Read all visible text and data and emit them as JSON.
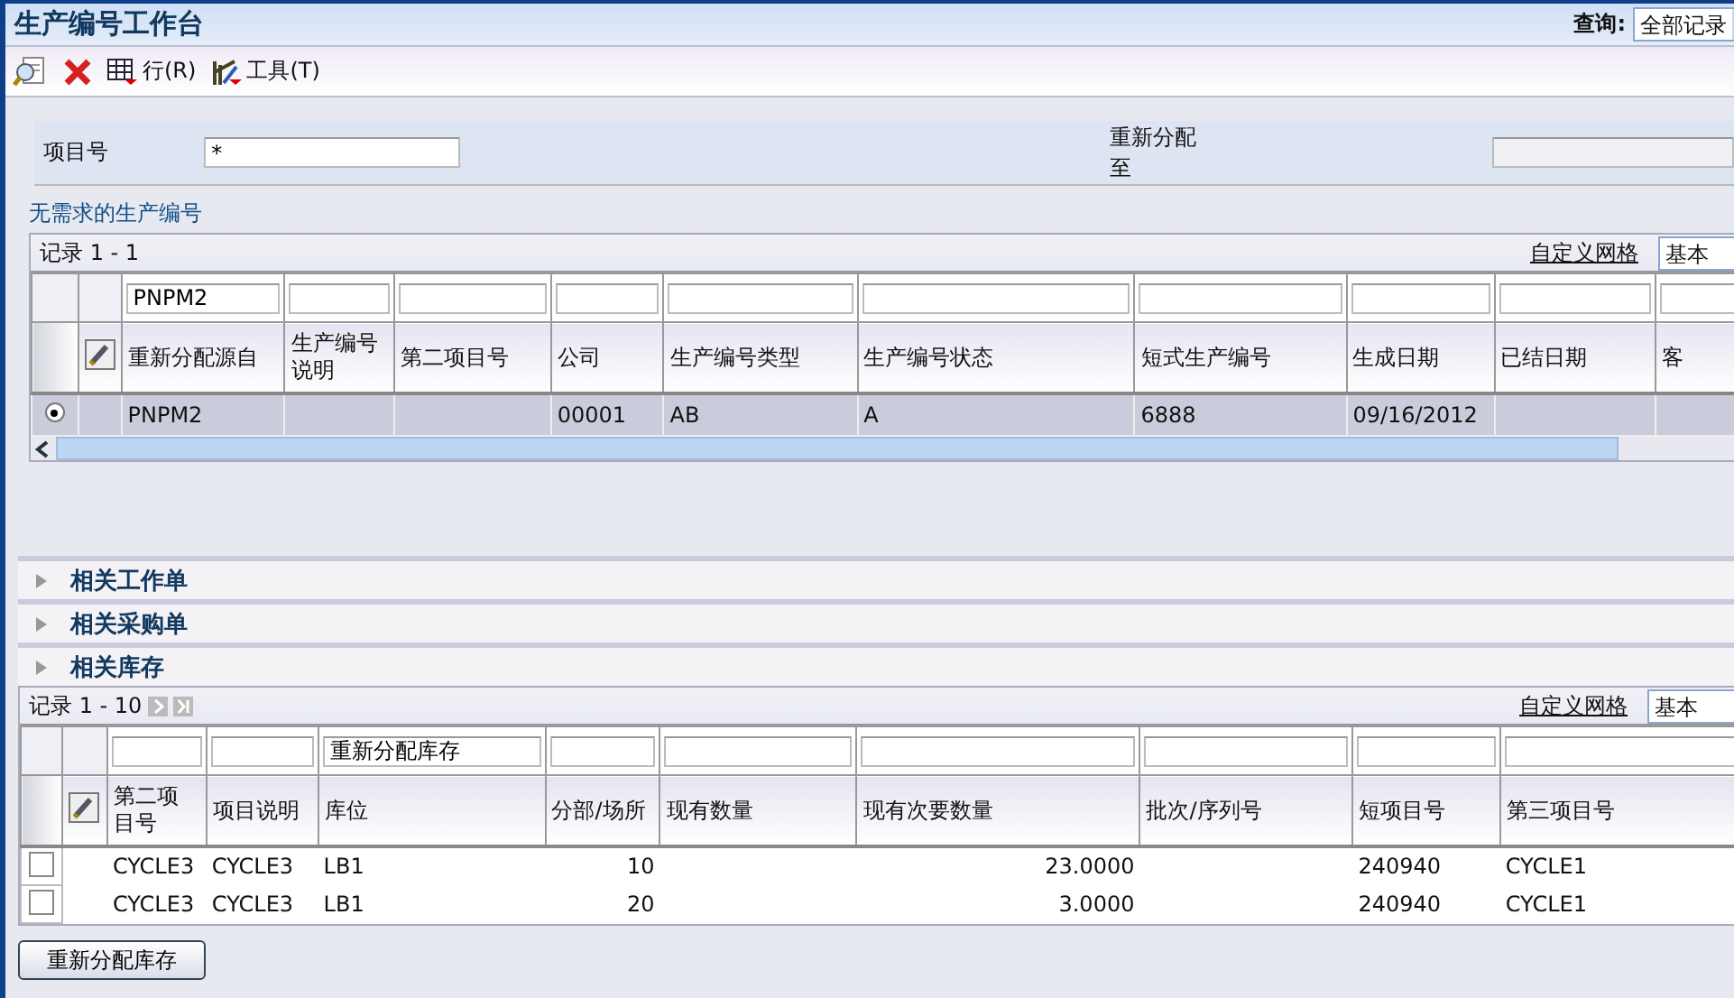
{
  "window": {
    "title": "生产编号工作台"
  },
  "query": {
    "label": "查询:",
    "value": "全部记录"
  },
  "toolbar": {
    "row_menu": "行(R)",
    "tools_menu": "工具(T)"
  },
  "form": {
    "item_number": {
      "label": "项目号",
      "value": "*"
    },
    "reassign_to": {
      "label": "重新分配至",
      "disabled": true
    }
  },
  "grid_unneeded": {
    "title": "无需求的生产编号",
    "records": "记录 1 - 1",
    "custom_grid": "自定义网格",
    "grid_format": "基本",
    "columns": [
      {
        "header": "重新分配源自",
        "filter": "PNPM2"
      },
      {
        "header": "生产编号说明"
      },
      {
        "header": "第二项目号"
      },
      {
        "header": "公司"
      },
      {
        "header": "生产编号类型"
      },
      {
        "header": "生产编号状态"
      },
      {
        "header": "短式生产编号"
      },
      {
        "header": "生成日期"
      },
      {
        "header": "已结日期"
      },
      {
        "header": "客"
      }
    ],
    "rows": [
      {
        "selected": true,
        "cells": [
          "PNPM2",
          null,
          null,
          "00001",
          "AB",
          "A",
          "6888",
          "09/16/2012",
          null,
          null
        ]
      }
    ]
  },
  "related_sections": [
    {
      "title": "相关工作单",
      "expanded": false
    },
    {
      "title": "相关采购单",
      "expanded": false
    },
    {
      "title": "相关库存",
      "expanded": false
    }
  ],
  "grid_inventory": {
    "records": "记录 1 - 10",
    "custom_grid": "自定义网格",
    "grid_format": "基本",
    "columns": [
      {
        "header": "第二项目号"
      },
      {
        "header": "项目说明"
      },
      {
        "header": "库位",
        "filter": "重新分配库存"
      },
      {
        "header": "分部/场所"
      },
      {
        "header": "现有数量"
      },
      {
        "header": "现有次要数量"
      },
      {
        "header": "批次/序列号"
      },
      {
        "header": "短项目号"
      },
      {
        "header": "第三项目号"
      }
    ],
    "rows": [
      {
        "checked": false,
        "cells": [
          "CYCLE3",
          "CYCLE3",
          "LB1",
          "10",
          null,
          "23.0000",
          null,
          "240940",
          "CYCLE1"
        ]
      },
      {
        "checked": false,
        "cells": [
          "CYCLE3",
          "CYCLE3",
          "LB1",
          "20",
          null,
          "3.0000",
          null,
          "240940",
          "CYCLE1"
        ]
      }
    ]
  },
  "button": "重新分配库存"
}
